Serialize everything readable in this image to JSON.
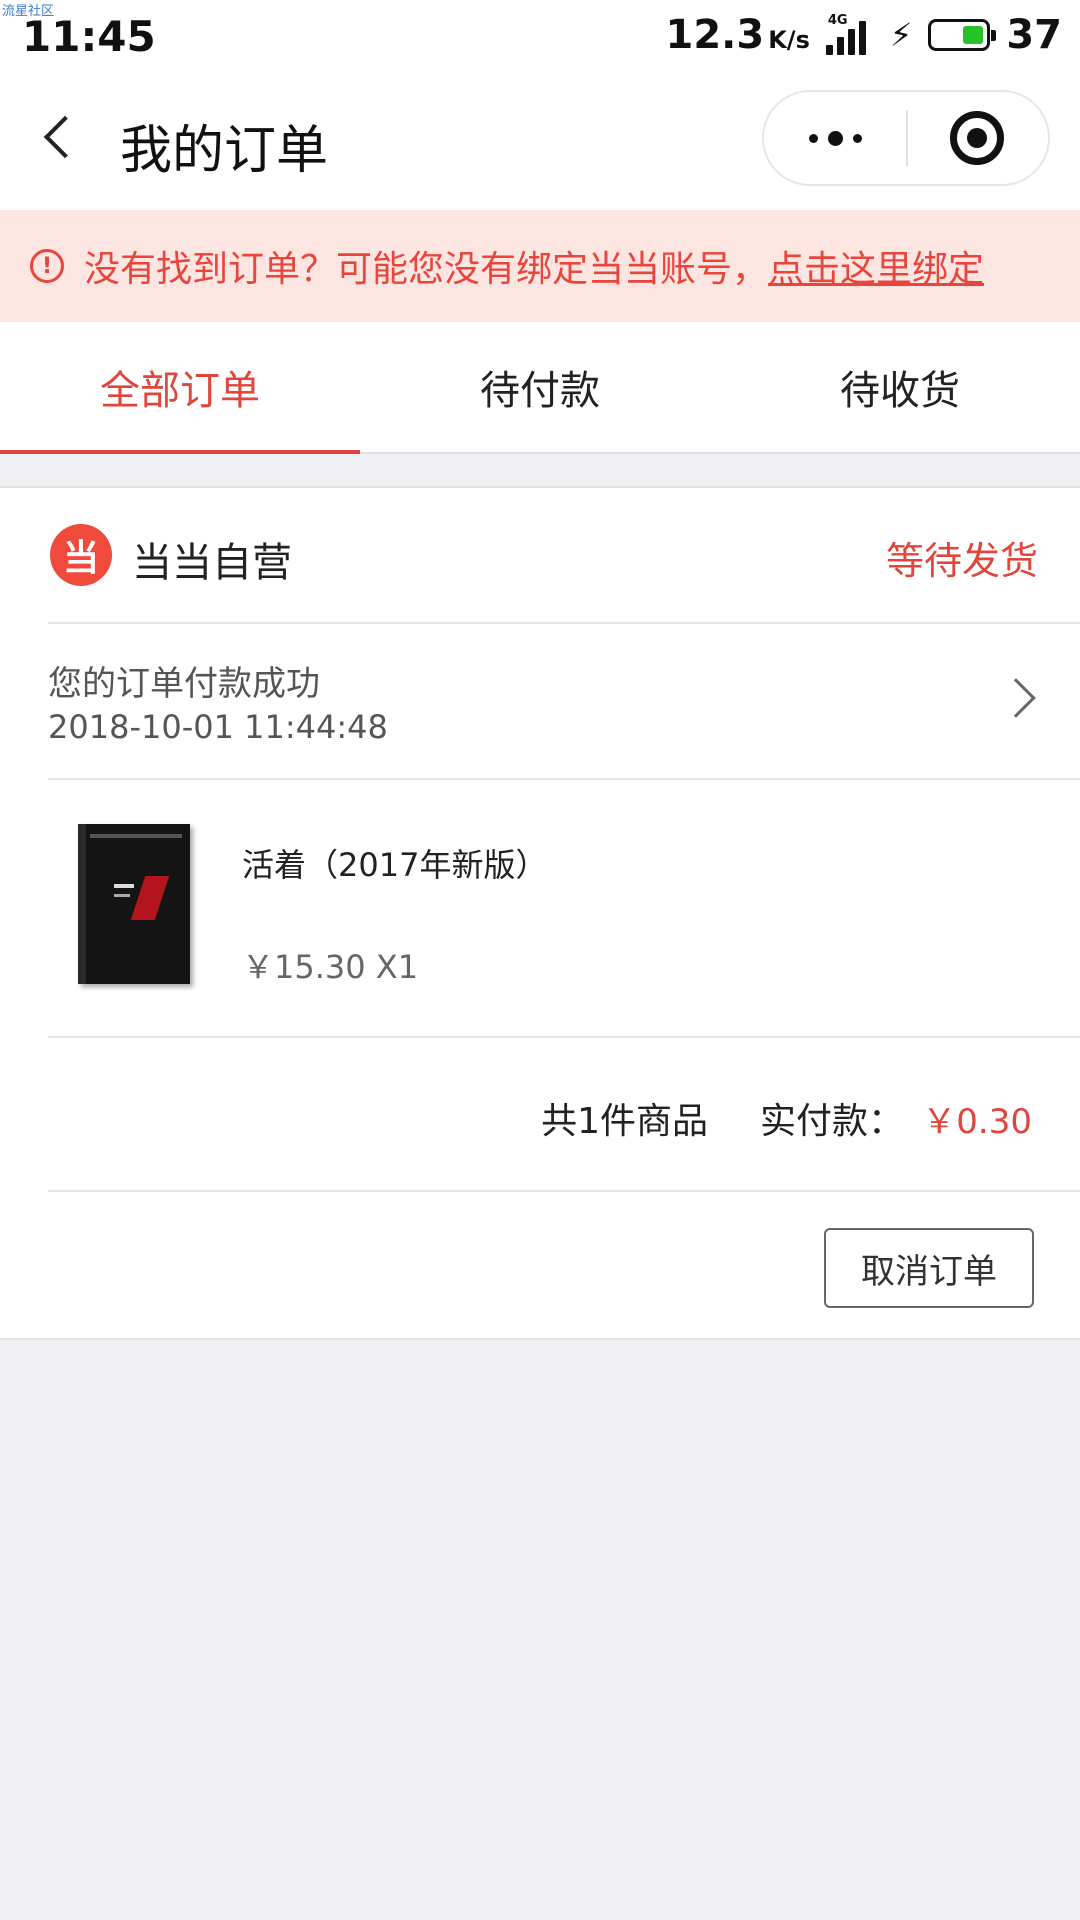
{
  "status_bar": {
    "watermark": "流星社区",
    "time": "11:45",
    "net_speed": "12.3",
    "net_unit": "K/s",
    "network_type": "4G",
    "battery_level": "37",
    "icons": [
      "signal-icon",
      "charging-icon",
      "battery-icon"
    ]
  },
  "nav": {
    "title": "我的订单",
    "icons": [
      "back-icon",
      "more-icon",
      "close-target-icon"
    ]
  },
  "notice": {
    "text": "没有找到订单？可能您没有绑定当当账号，",
    "link": "点击这里绑定",
    "icon": "alert-circle-icon",
    "icon_glyph": "!",
    "color": "#e8453c",
    "background": "#fde5e1"
  },
  "tabs": [
    {
      "label": "全部订单",
      "active": true
    },
    {
      "label": "待付款",
      "active": false
    },
    {
      "label": "待收货",
      "active": false
    }
  ],
  "order": {
    "shop": {
      "logo_glyph": "当",
      "name": "当当自营"
    },
    "status": "等待发货",
    "message": "您的订单付款成功",
    "time": "2018-10-01 11:44:48",
    "product": {
      "title": "活着（2017年新版）",
      "price": "￥15.30 X1"
    },
    "summary": {
      "count": "共1件商品",
      "paid_label": "实付款：",
      "paid_value": "￥0.30"
    },
    "cancel_label": "取消订单"
  },
  "colors": {
    "accent": "#e0463c",
    "background": "#efeff4",
    "battery": "#27c227"
  }
}
